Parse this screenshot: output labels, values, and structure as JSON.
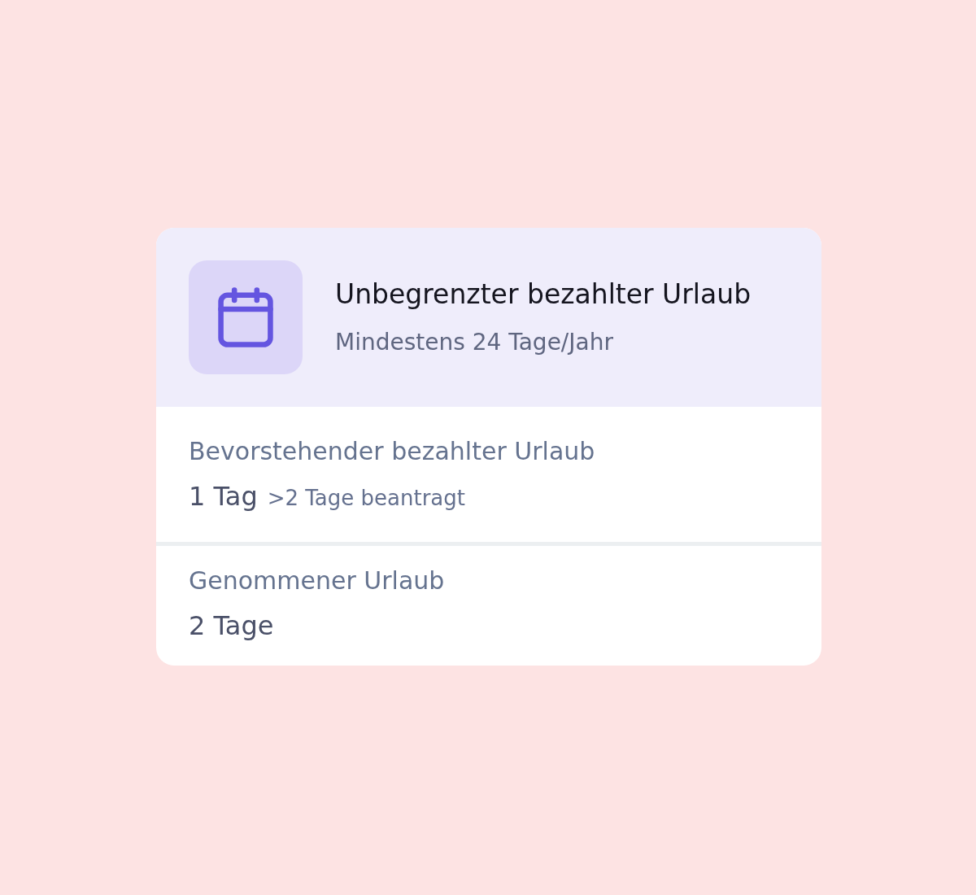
{
  "card": {
    "header": {
      "title": "Unbegrenzter bezahlter Urlaub",
      "subtitle": "Mindestens 24 Tage/Jahr"
    },
    "sections": [
      {
        "label": "Bevorstehender bezahlter Urlaub",
        "value": "1 Tag",
        "note": ">2 Tage beantragt"
      },
      {
        "label": "Genommener Urlaub",
        "value": "2 Tage"
      }
    ]
  }
}
